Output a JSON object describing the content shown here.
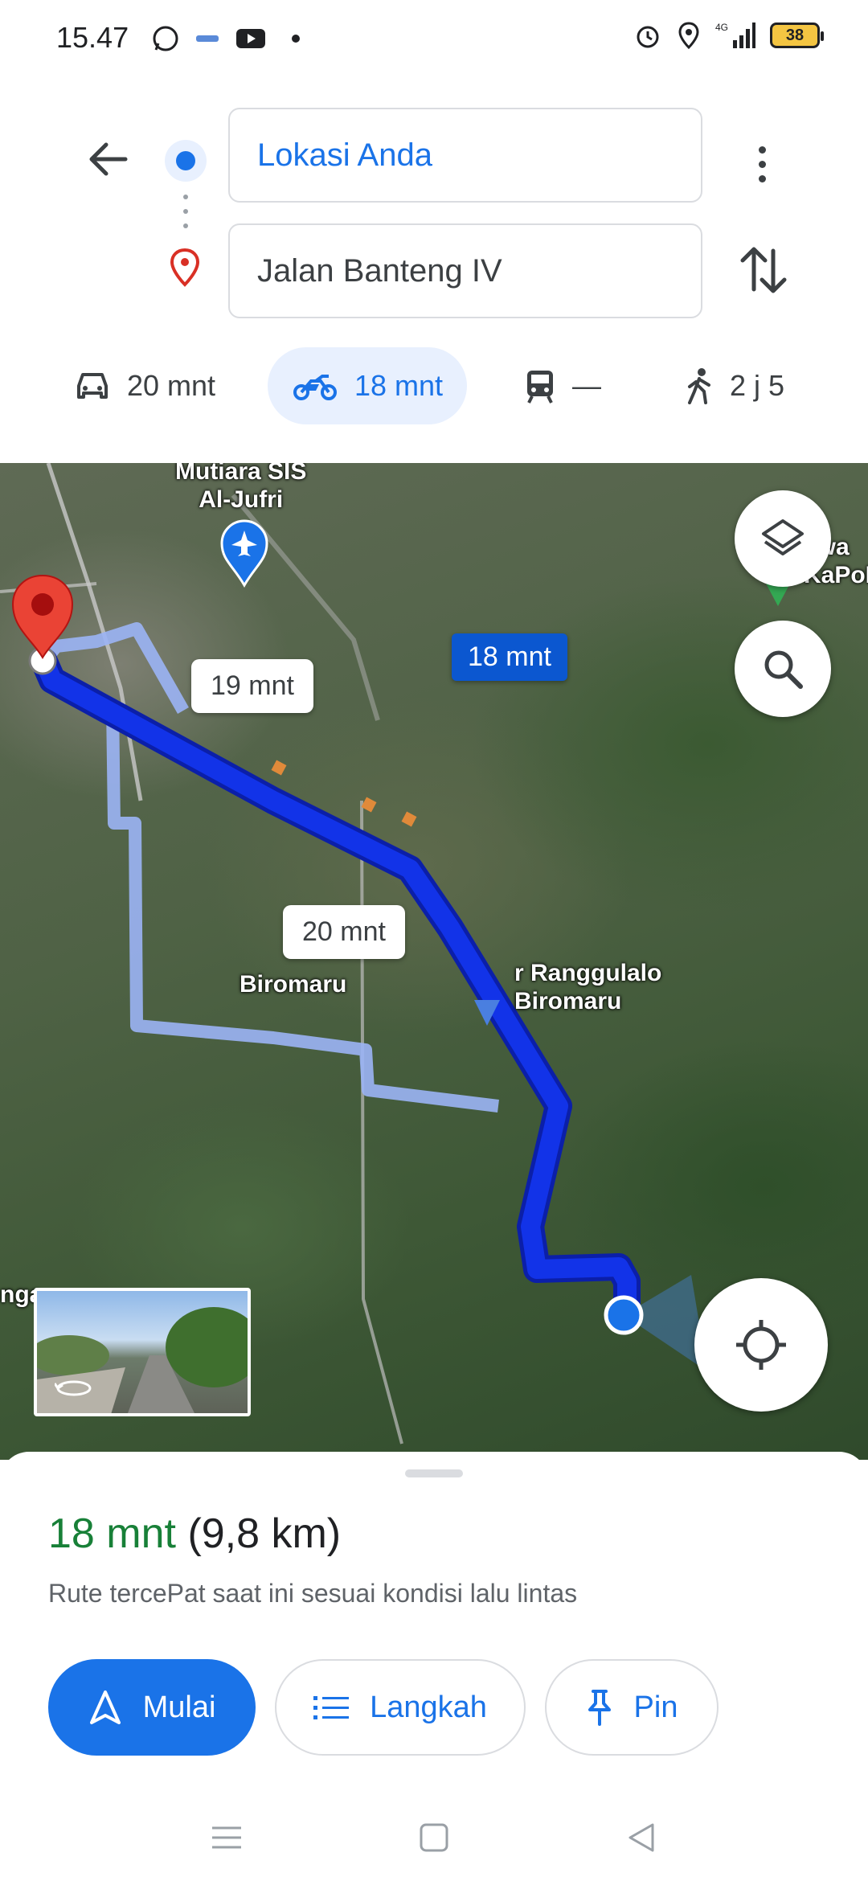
{
  "status_bar": {
    "time": "15.47",
    "battery": "38",
    "network": "4G"
  },
  "search": {
    "origin": "Lokasi Anda",
    "destination": "Jalan Banteng IV"
  },
  "modes": [
    {
      "icon": "car-icon",
      "label": "20 mnt",
      "active": false
    },
    {
      "icon": "motorcycle-icon",
      "label": "18 mnt",
      "active": true
    },
    {
      "icon": "transit-icon",
      "label": "—",
      "active": false
    },
    {
      "icon": "walk-icon",
      "label": "2 j 5",
      "active": false
    }
  ],
  "map": {
    "labels": {
      "airport": "Mutiara SIS\nAl-Jufri",
      "biromaru": "Biromaru",
      "ranggulalo": "r Ranggulalo\nBiromaru",
      "top_right": "awa\nKaPoF",
      "left_edge": "nga"
    },
    "route_bubbles": {
      "alt1": "19 mnt",
      "selected": "18 mnt",
      "alt2": "20 mnt"
    },
    "colors": {
      "selected_route": "#1233e8",
      "alt_route": "#9bb4f5"
    }
  },
  "sheet": {
    "time": "18 mnt",
    "distance": "(9,8 km)",
    "note": "Rute tercePat saat ini sesuai kondisi lalu lintas",
    "buttons": {
      "start": "Mulai",
      "steps": "Langkah",
      "pin": "Pin"
    }
  }
}
